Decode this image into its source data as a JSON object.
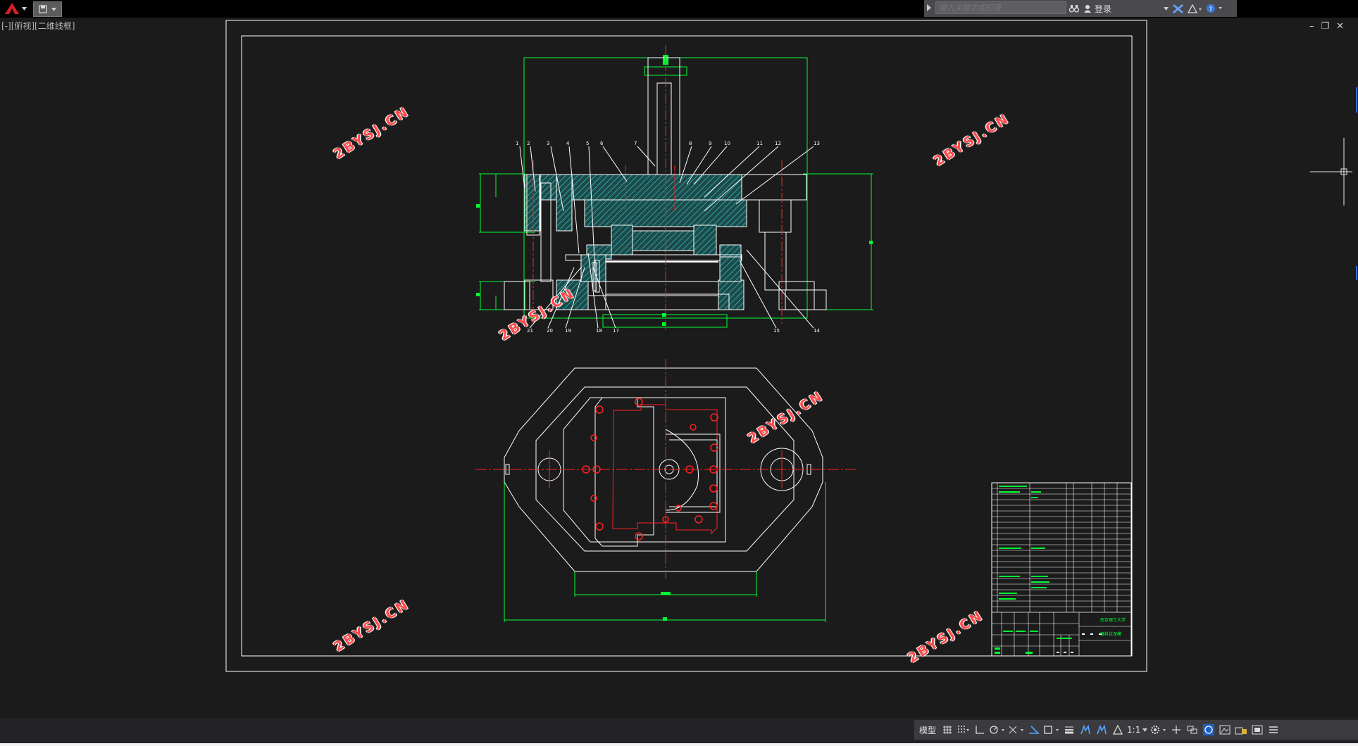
{
  "app": {
    "menu_icon": "autocad-a-logo"
  },
  "quick_access": {
    "icon": "save-dropdown-icon"
  },
  "search": {
    "placeholder": "键入关键字或短语",
    "login_label": "登录"
  },
  "viewport": {
    "label": "[-][俯视][二维线框]"
  },
  "watermarks": [
    "2BYSJ.CN",
    "2BYSJ.CN",
    "2BYSJ.CN",
    "2BYSJ.CN",
    "2BYSJ.CN",
    "2BYSJ.CN"
  ],
  "status_bar": {
    "model_label": "模型",
    "scale_label": "1:1",
    "buttons": [
      "grid",
      "snap",
      "ortho",
      "polar",
      "isodraft",
      "osnap",
      "otrack",
      "dyn-ucs",
      "lineweight",
      "transparency",
      "selection-cycling",
      "annotation-visibility",
      "auto-scale",
      "annotation-scale",
      "workspace",
      "annotation-monitor",
      "units",
      "quick-properties",
      "lock-ui",
      "isolate",
      "hardware-acceleration",
      "clean-screen",
      "customize"
    ]
  },
  "title_block": {
    "school": "南京理工大学",
    "drawing_name": "落料拉深模"
  },
  "colors": {
    "drawing_bg": "#1b1b1c",
    "line_white": "#ffffff",
    "dim_green": "#00ff33",
    "center_red": "#ff2020",
    "hatch_cyan": "#36c7c7",
    "watermark": "#ff4a4a"
  }
}
